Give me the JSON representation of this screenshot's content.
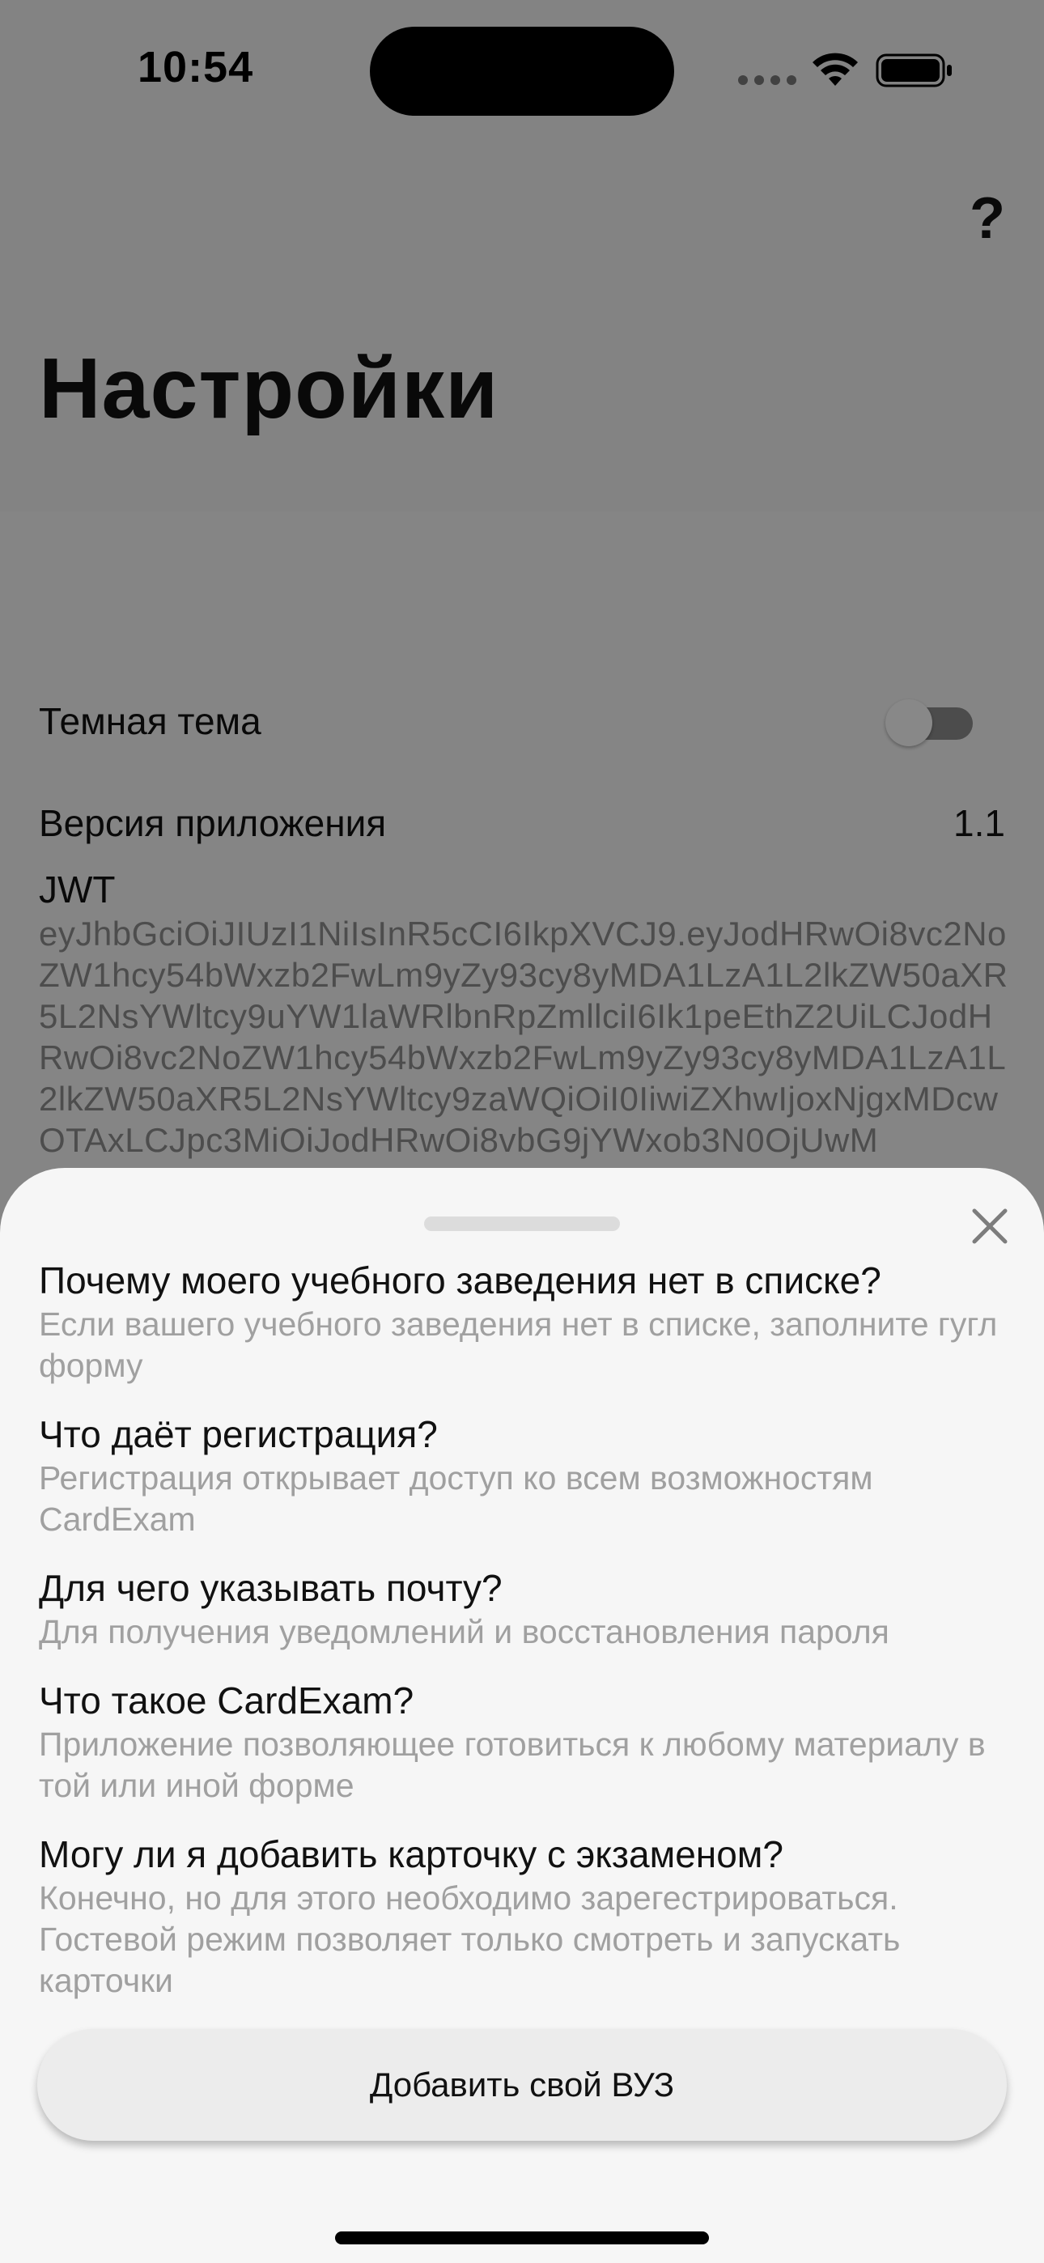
{
  "status_bar": {
    "time": "10:54"
  },
  "header": {
    "help_label": "?",
    "title": "Настройки"
  },
  "settings": {
    "dark_theme_label": "Темная тема",
    "dark_theme_enabled": false,
    "version_label": "Версия приложения",
    "version_value": "1.1",
    "jwt_label": "JWT",
    "jwt_value": "eyJhbGciOiJIUzI1NiIsInR5cCI6IkpXVCJ9.eyJodHRwOi8vc2NoZW1hcy54bWxzb2FwLm9yZy93cy8yMDA1LzA1L2lkZW50aXR5L2NsYWltcy9uYW1laWRlbnRpZmllciI6Ik1peEthZ2UiLCJodHRwOi8vc2NoZW1hcy54bWxzb2FwLm9yZy93cy8yMDA1LzA1L2lkZW50aXR5L2NsYWltcy9zaWQiOiI0IiwiZXhwIjoxNjgxMDcwOTAxLCJpc3MiOiJodHRwOi8vbG9jYWxob3N0OjUwM"
  },
  "faq_sheet": {
    "close_icon": "close-icon",
    "items": [
      {
        "question": "Почему моего учебного заведения нет в списке?",
        "answer": "Если вашего учебного заведения нет в списке, заполните гугл форму"
      },
      {
        "question": "Что даёт регистрация?",
        "answer": "Регистрация открывает доступ ко всем возможностям CardExam"
      },
      {
        "question": "Для чего указывать почту?",
        "answer": "Для получения уведомлений и восстановления пароля"
      },
      {
        "question": "Что такое CardExam?",
        "answer": "Приложение позволяющее готовиться к любому материалу в той или иной форме"
      },
      {
        "question": "Могу ли я добавить карточку с экзаменом?",
        "answer": "Конечно, но для этого необходимо зарегестрироваться. Гостевой режим позволяет только смотреть и запускать карточки"
      }
    ],
    "add_university_label": "Добавить свой ВУЗ"
  }
}
